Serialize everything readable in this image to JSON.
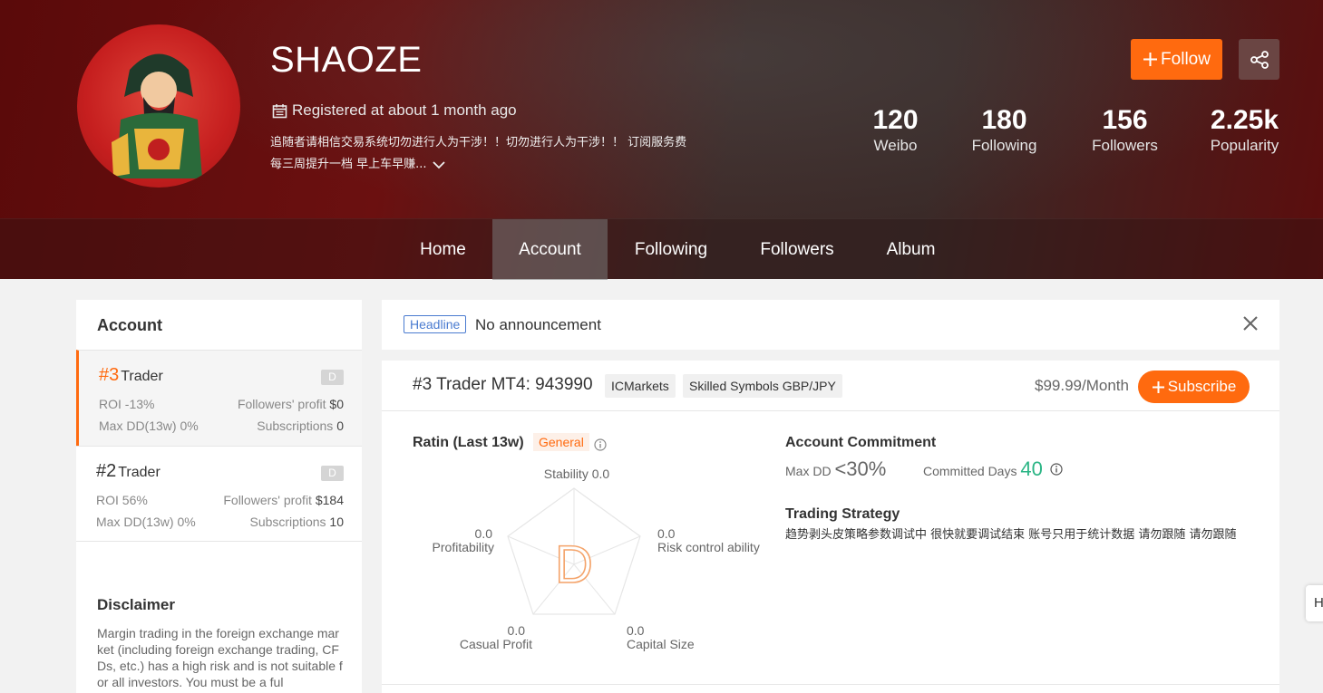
{
  "profile": {
    "username": "SHAOZE",
    "registered": "Registered at about 1 month ago",
    "bio_line1": "追随者请相信交易系统切勿进行人为干涉！！切勿进行人为干涉！！ 订阅服务费",
    "bio_line2": "每三周提升一档 早上车早赚..."
  },
  "actions": {
    "follow_label": "Follow"
  },
  "stats": [
    {
      "value": "120",
      "label": "Weibo"
    },
    {
      "value": "180",
      "label": "Following"
    },
    {
      "value": "156",
      "label": "Followers"
    },
    {
      "value": "2.25k",
      "label": "Popularity"
    }
  ],
  "nav": {
    "items": [
      "Home",
      "Account",
      "Following",
      "Followers",
      "Album"
    ],
    "active": "Account"
  },
  "sidebar": {
    "title": "Account",
    "accounts": [
      {
        "rank": "#3",
        "name": "Trader",
        "grade": "D",
        "roi": "ROI -13%",
        "followers_profit_label": "Followers' profit",
        "followers_profit": "$0",
        "maxdd": "Max DD(13w) 0%",
        "subscriptions_label": "Subscriptions",
        "subscriptions": "0"
      },
      {
        "rank": "#2",
        "name": "Trader",
        "grade": "D",
        "roi": "ROI 56%",
        "followers_profit_label": "Followers' profit",
        "followers_profit": "$184",
        "maxdd": "Max DD(13w) 0%",
        "subscriptions_label": "Subscriptions",
        "subscriptions": "10"
      }
    ],
    "disclaimer_title": "Disclaimer",
    "disclaimer_text": "Margin trading in the foreign exchange market (including foreign exchange trading, CFDs, etc.) has a high risk and is not suitable for all investors. You must be a ful"
  },
  "announcement": {
    "tag": "Headline",
    "text": "No announcement"
  },
  "account_card": {
    "title": "#3 Trader MT4: 943990",
    "broker": "ICMarkets",
    "symbols": "Skilled Symbols GBP/JPY",
    "price": "$99.99/Month",
    "subscribe_label": "Subscribe",
    "ratin_title": "Ratin (Last 13w)",
    "ratin_tag": "General",
    "grade": "D",
    "radar": {
      "stability": {
        "label": "Stability",
        "value": "0.0"
      },
      "risk": {
        "label": "Risk control ability",
        "value": "0.0"
      },
      "capital": {
        "label": "Capital Size",
        "value": "0.0"
      },
      "casual": {
        "label": "Casual Profit",
        "value": "0.0"
      },
      "profitability": {
        "label": "Profitability",
        "value": "0.0"
      }
    },
    "commitment_title": "Account Commitment",
    "maxdd_label": "Max DD",
    "maxdd_value": "<30%",
    "committed_label": "Committed Days",
    "committed_value": "40",
    "strategy_title": "Trading Strategy",
    "strategy_text": "趋势剥头皮策略参数调试中 很快就要调试结束 账号只用于统计数据 请勿跟随 请勿跟随"
  },
  "side_tab": "H",
  "colors": {
    "accent": "#ff6a0f",
    "green": "#2bb585",
    "link": "#4a7bd0"
  }
}
